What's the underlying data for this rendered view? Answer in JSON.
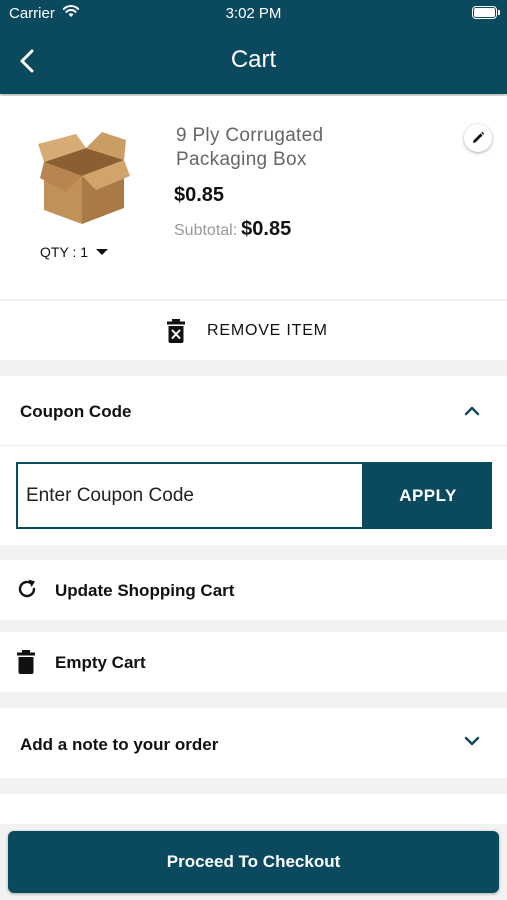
{
  "status_bar": {
    "carrier": "Carrier",
    "time": "3:02 PM"
  },
  "header": {
    "title": "Cart",
    "back_icon": "chevron-left-icon"
  },
  "cart_item": {
    "name": "9 Ply Corrugated Packaging Box",
    "price": "$0.85",
    "subtotal_label": "Subtotal:",
    "subtotal_value": "$0.85",
    "qty_label": "QTY : 1",
    "image_icon": "cardboard-box-icon",
    "edit_icon": "pencil-icon"
  },
  "remove_item": {
    "label": "REMOVE ITEM",
    "icon": "trash-x-icon"
  },
  "coupon": {
    "title": "Coupon Code",
    "placeholder": "Enter Coupon Code",
    "apply_label": "APPLY",
    "chevron_icon": "chevron-up-icon"
  },
  "actions": {
    "update_label": "Update Shopping Cart",
    "update_icon": "refresh-icon",
    "empty_label": "Empty Cart",
    "empty_icon": "trash-icon"
  },
  "note": {
    "label": "Add a note to your order",
    "chevron_icon": "chevron-down-icon"
  },
  "checkout": {
    "label": "Proceed To Checkout"
  },
  "colors": {
    "primary": "#0b4a5e",
    "background": "#f2f2f2",
    "muted_text": "#999999"
  }
}
